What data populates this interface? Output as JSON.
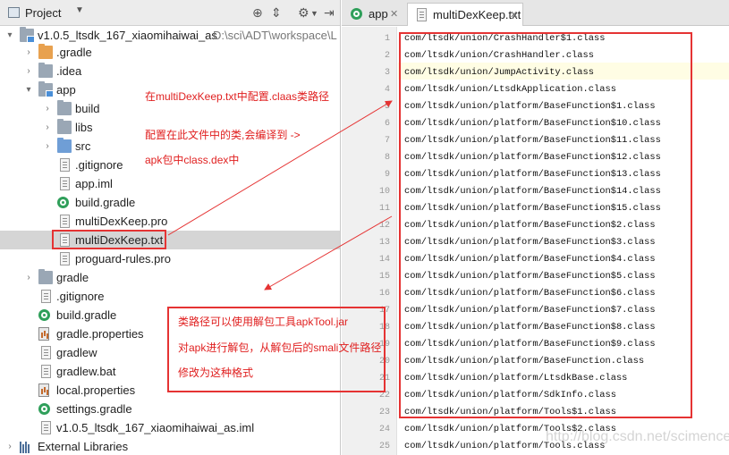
{
  "project_panel": {
    "title": "Project",
    "root_path": "D:\\sci\\ADT\\workspace\\L",
    "tree": [
      {
        "label": "v1.0.5_ltsdk_167_xiaomihaiwai_as",
        "icon": "module-folder-icon"
      },
      {
        "label": ".gradle",
        "icon": "folder-icon"
      },
      {
        "label": ".idea",
        "icon": "folder-icon"
      },
      {
        "label": "app",
        "icon": "module-folder-icon"
      },
      {
        "label": "build",
        "icon": "folder-icon"
      },
      {
        "label": "libs",
        "icon": "folder-icon"
      },
      {
        "label": "src",
        "icon": "folder-icon"
      },
      {
        "label": ".gitignore",
        "icon": "file-icon"
      },
      {
        "label": "app.iml",
        "icon": "file-icon"
      },
      {
        "label": "build.gradle",
        "icon": "gradle-icon"
      },
      {
        "label": "multiDexKeep.pro",
        "icon": "file-icon"
      },
      {
        "label": "multiDexKeep.txt",
        "icon": "file-icon"
      },
      {
        "label": "proguard-rules.pro",
        "icon": "file-icon"
      },
      {
        "label": "gradle",
        "icon": "folder-icon"
      },
      {
        "label": ".gitignore",
        "icon": "file-icon"
      },
      {
        "label": "build.gradle",
        "icon": "gradle-icon"
      },
      {
        "label": "gradle.properties",
        "icon": "properties-icon"
      },
      {
        "label": "gradlew",
        "icon": "file-icon"
      },
      {
        "label": "gradlew.bat",
        "icon": "file-icon"
      },
      {
        "label": "local.properties",
        "icon": "properties-icon"
      },
      {
        "label": "settings.gradle",
        "icon": "gradle-icon"
      },
      {
        "label": "v1.0.5_ltsdk_167_xiaomihaiwai_as.iml",
        "icon": "file-icon"
      },
      {
        "label": "External Libraries",
        "icon": "libraries-icon"
      }
    ]
  },
  "editor": {
    "tabs": [
      {
        "label": "app"
      },
      {
        "label": "multiDexKeep.txt"
      }
    ],
    "lines": [
      {
        "n": "1",
        "text": "com/ltsdk/union/CrashHandler$1.class"
      },
      {
        "n": "2",
        "text": "com/ltsdk/union/CrashHandler.class"
      },
      {
        "n": "3",
        "text": "com/ltsdk/union/JumpActivity.class"
      },
      {
        "n": "4",
        "text": "com/ltsdk/union/LtsdkApplication.class"
      },
      {
        "n": "5",
        "text": "com/ltsdk/union/platform/BaseFunction$1.class"
      },
      {
        "n": "6",
        "text": "com/ltsdk/union/platform/BaseFunction$10.class"
      },
      {
        "n": "7",
        "text": "com/ltsdk/union/platform/BaseFunction$11.class"
      },
      {
        "n": "8",
        "text": "com/ltsdk/union/platform/BaseFunction$12.class"
      },
      {
        "n": "9",
        "text": "com/ltsdk/union/platform/BaseFunction$13.class"
      },
      {
        "n": "10",
        "text": "com/ltsdk/union/platform/BaseFunction$14.class"
      },
      {
        "n": "11",
        "text": "com/ltsdk/union/platform/BaseFunction$15.class"
      },
      {
        "n": "12",
        "text": "com/ltsdk/union/platform/BaseFunction$2.class"
      },
      {
        "n": "13",
        "text": "com/ltsdk/union/platform/BaseFunction$3.class"
      },
      {
        "n": "14",
        "text": "com/ltsdk/union/platform/BaseFunction$4.class"
      },
      {
        "n": "15",
        "text": "com/ltsdk/union/platform/BaseFunction$5.class"
      },
      {
        "n": "16",
        "text": "com/ltsdk/union/platform/BaseFunction$6.class"
      },
      {
        "n": "17",
        "text": "com/ltsdk/union/platform/BaseFunction$7.class"
      },
      {
        "n": "18",
        "text": "com/ltsdk/union/platform/BaseFunction$8.class"
      },
      {
        "n": "19",
        "text": "com/ltsdk/union/platform/BaseFunction$9.class"
      },
      {
        "n": "20",
        "text": "com/ltsdk/union/platform/BaseFunction.class"
      },
      {
        "n": "21",
        "text": "com/ltsdk/union/platform/LtsdkBase.class"
      },
      {
        "n": "22",
        "text": "com/ltsdk/union/platform/SdkInfo.class"
      },
      {
        "n": "23",
        "text": "com/ltsdk/union/platform/Tools$1.class"
      },
      {
        "n": "24",
        "text": "com/ltsdk/union/platform/Tools$2.class"
      },
      {
        "n": "25",
        "text": "com/ltsdk/union/platform/Tools.class"
      }
    ]
  },
  "annotations": {
    "note1_line1": "在multiDexKeep.txt中配置.claas类路径",
    "note1_line2": "配置在此文件中的类,会编译到   ->",
    "note1_line3": "apk包中class.dex中",
    "note2_line1": "类路径可以使用解包工具apkTool.jar",
    "note2_line2": "对apk进行解包，从解包后的smali文件路径",
    "note2_line3": "修改为这种格式",
    "color": "#e02020"
  },
  "watermark": "http://blog.csdn.net/scimence"
}
